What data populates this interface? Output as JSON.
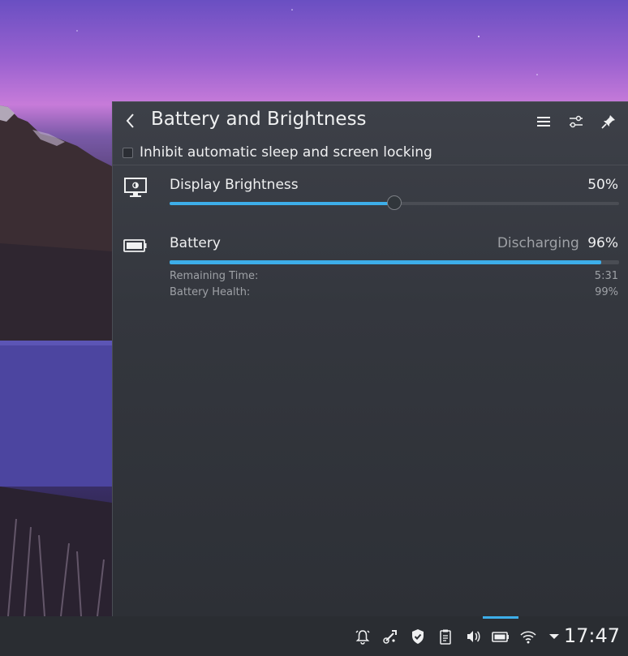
{
  "popup": {
    "title": "Battery and Brightness",
    "inhibit_label": "Inhibit automatic sleep and screen locking",
    "inhibit_checked": false
  },
  "brightness": {
    "label": "Display Brightness",
    "value_text": "50%",
    "level": 0.5,
    "icon": "display-brightness-icon"
  },
  "battery": {
    "label": "Battery",
    "state": "Discharging",
    "percent_text": "96%",
    "level": 0.96,
    "icon": "battery-icon",
    "details": [
      {
        "label": "Remaining Time:",
        "value": "5:31"
      },
      {
        "label": "Battery Health:",
        "value": "99%"
      }
    ]
  },
  "header_icons": [
    "hamburger-menu-icon",
    "configure-icon",
    "pin-icon"
  ],
  "tray": {
    "icons": [
      "notifications-icon",
      "kde-connect-icon",
      "security-shield-icon",
      "clipboard-icon",
      "volume-icon",
      "battery-icon",
      "wifi-icon",
      "expand-arrow-icon"
    ],
    "clock": "17:47"
  },
  "colors": {
    "accent": "#3daee9",
    "panel_bg": "#34373e",
    "text": "#eff0f1",
    "text_dim": "#9ea1a6"
  }
}
